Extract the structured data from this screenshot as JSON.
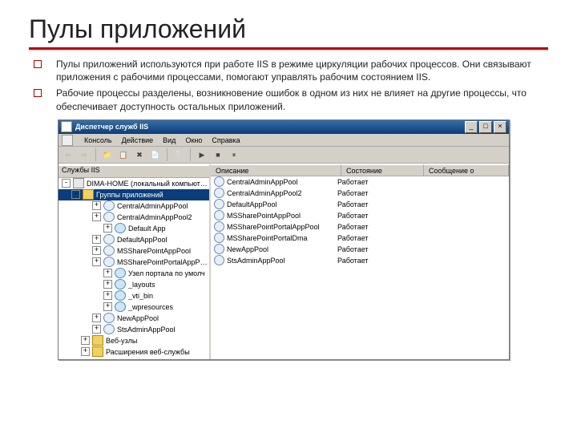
{
  "slide": {
    "title": "Пулы приложений",
    "bullets": [
      "Пулы приложений используются при работе IIS в режиме циркуляции рабочих процессов. Они связывают приложения с рабочими процессами, помогают управлять рабочим состоянием IIS.",
      "Рабочие процессы разделены, возникновение ошибок в одном из них не влияет на другие процессы, что обеспечивает доступность остальных приложений."
    ]
  },
  "window": {
    "title": "Диспетчер служб IIS",
    "menu": [
      "Консоль",
      "Действие",
      "Вид",
      "Окно",
      "Справка"
    ]
  },
  "tree": {
    "header": "Службы IIS",
    "root": "DIMA-HOME (локальный компьютер)",
    "selected": "Группы приложений",
    "nodes": [
      {
        "indent": 1,
        "label": "CentralAdminAppPool",
        "icon": "gear"
      },
      {
        "indent": 1,
        "label": "CentralAdminAppPool2",
        "icon": "gear"
      },
      {
        "indent": 2,
        "label": "Default App",
        "icon": "globe"
      },
      {
        "indent": 1,
        "label": "DefaultAppPool",
        "icon": "gear"
      },
      {
        "indent": 1,
        "label": "MSSharePointAppPool",
        "icon": "gear"
      },
      {
        "indent": 1,
        "label": "MSSharePointPortalAppPool",
        "icon": "gear"
      },
      {
        "indent": 2,
        "label": "Узел портала по умолч",
        "icon": "globe"
      },
      {
        "indent": 2,
        "label": "_layouts",
        "icon": "globe"
      },
      {
        "indent": 2,
        "label": "_vti_bin",
        "icon": "globe"
      },
      {
        "indent": 2,
        "label": "_wpresources",
        "icon": "globe"
      },
      {
        "indent": 1,
        "label": "NewAppPool",
        "icon": "gear"
      },
      {
        "indent": 1,
        "label": "StsAdminAppPool",
        "icon": "gear"
      },
      {
        "indent": 0,
        "label": "Веб-узлы",
        "icon": "folder"
      },
      {
        "indent": 0,
        "label": "Расширения веб-службы",
        "icon": "folder"
      }
    ]
  },
  "list": {
    "headers": [
      "Описание",
      "Состояние",
      "Сообщение о состоянии"
    ],
    "rows": [
      {
        "desc": "CentralAdminAppPool",
        "state": "Работает"
      },
      {
        "desc": "CentralAdminAppPool2",
        "state": "Работает"
      },
      {
        "desc": "DefaultAppPool",
        "state": "Работает"
      },
      {
        "desc": "MSSharePointAppPool",
        "state": "Работает"
      },
      {
        "desc": "MSSharePointPortalAppPool",
        "state": "Работает"
      },
      {
        "desc": "MSSharePointPortalDma",
        "state": "Работает"
      },
      {
        "desc": "NewAppPool",
        "state": "Работает"
      },
      {
        "desc": "StsAdminAppPool",
        "state": "Работает"
      }
    ]
  }
}
